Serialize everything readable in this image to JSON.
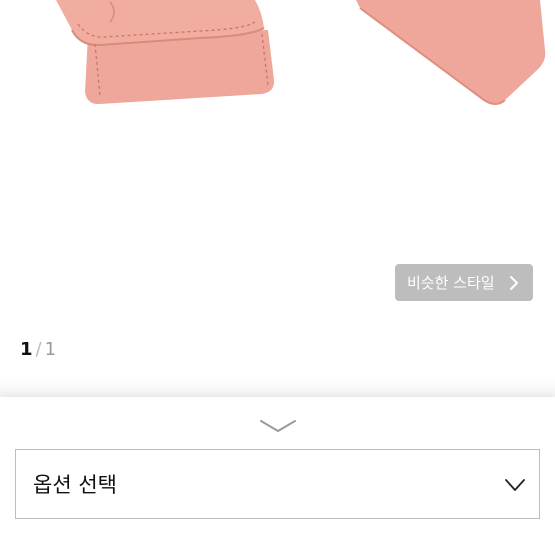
{
  "product": {
    "image_alt": "pink leather case"
  },
  "similar_style": {
    "label": "비슷한 스타일"
  },
  "pager": {
    "current": "1",
    "separator": "/",
    "total": "1"
  },
  "sheet": {
    "option_select_label": "옵션 선택"
  },
  "colors": {
    "leather_main": "#eea79a",
    "leather_shade": "#e49384",
    "button_bg": "#a9a9a9",
    "border": "#bdbdbd"
  },
  "icons": {
    "similar_chevron": "chevron-right-icon",
    "handle": "chevron-down-icon",
    "dropdown": "chevron-down-icon"
  }
}
